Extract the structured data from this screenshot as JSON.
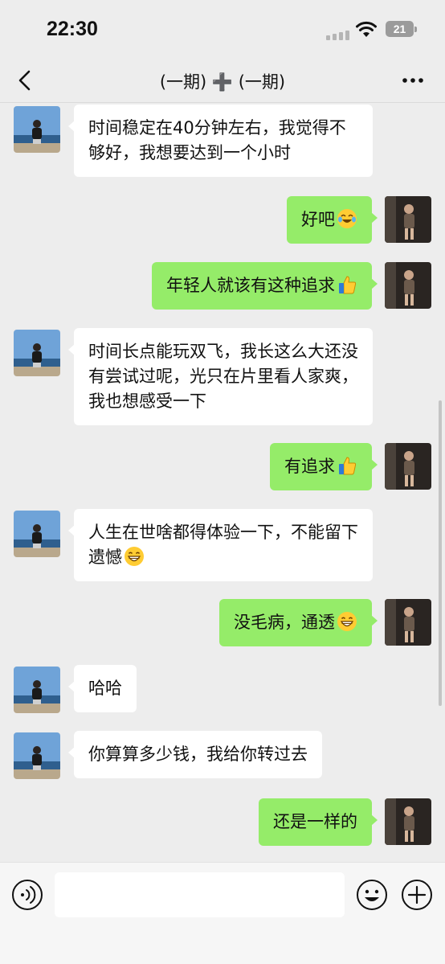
{
  "status_bar": {
    "time": "22:30",
    "battery": "21"
  },
  "nav": {
    "title": "(一期) ➕ (一期)"
  },
  "messages": [
    {
      "side": "left",
      "text": "时间稳定在40分钟左右，我觉得不够好，我想要达到一个小时",
      "emoji": ""
    },
    {
      "side": "right",
      "text": "好吧",
      "emoji": "laughing-tears-emoji"
    },
    {
      "side": "right",
      "text": "年轻人就该有这种追求",
      "emoji": "thumbs-up-emoji"
    },
    {
      "side": "left",
      "text": "时间长点能玩双飞，我长这么大还没有尝试过呢，光只在片里看人家爽，我也想感受一下",
      "emoji": ""
    },
    {
      "side": "right",
      "text": "有追求",
      "emoji": "thumbs-up-emoji"
    },
    {
      "side": "left",
      "text": "人生在世啥都得体验一下，不能留下遗憾",
      "emoji": "grinning-emoji"
    },
    {
      "side": "right",
      "text": "没毛病，通透",
      "emoji": "grinning-emoji"
    },
    {
      "side": "left",
      "text": "哈哈",
      "emoji": ""
    },
    {
      "side": "left",
      "text": "你算算多少钱，我给你转过去",
      "emoji": ""
    },
    {
      "side": "right",
      "text": "还是一样的",
      "emoji": ""
    }
  ],
  "input": {
    "value": "",
    "placeholder": ""
  },
  "colors": {
    "outgoing_bubble": "#95ec69",
    "incoming_bubble": "#ffffff",
    "background": "#ededed"
  }
}
